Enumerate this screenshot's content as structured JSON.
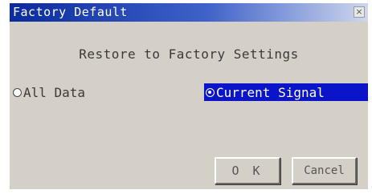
{
  "dialog": {
    "title": "Factory Default",
    "close_glyph": "×",
    "prompt": "Restore to Factory Settings",
    "options": [
      {
        "label": "All Data",
        "selected": false
      },
      {
        "label": "Current Signal",
        "selected": true
      }
    ],
    "ok_label": "O K",
    "cancel_label": "Cancel"
  },
  "colors": {
    "title_bar": "#0a2a9e",
    "selection_highlight": "#0a14c8",
    "dialog_bg": "#d4d0c8"
  }
}
